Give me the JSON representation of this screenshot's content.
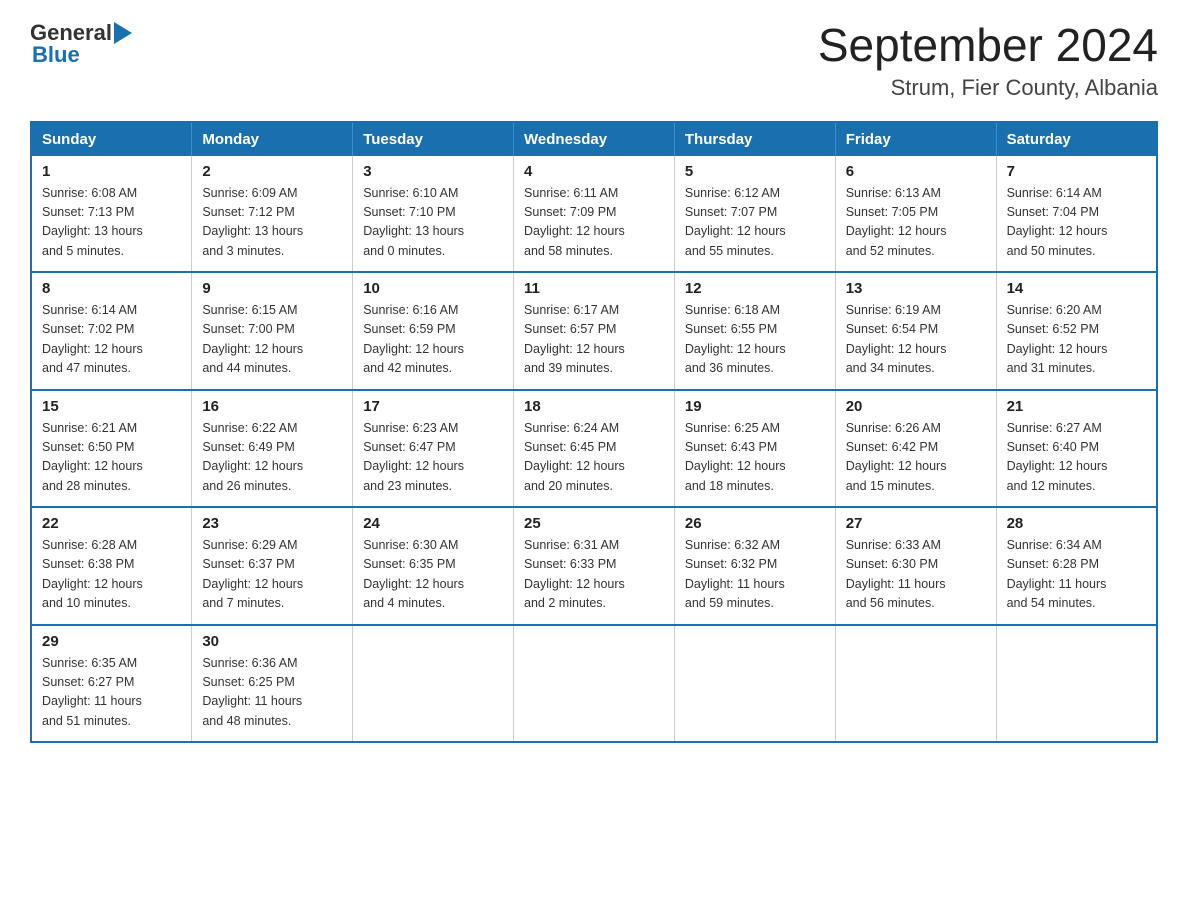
{
  "header": {
    "logo_general": "General",
    "logo_blue": "Blue",
    "month_year": "September 2024",
    "location": "Strum, Fier County, Albania"
  },
  "days_of_week": [
    "Sunday",
    "Monday",
    "Tuesday",
    "Wednesday",
    "Thursday",
    "Friday",
    "Saturday"
  ],
  "weeks": [
    [
      {
        "day": "1",
        "sunrise": "6:08 AM",
        "sunset": "7:13 PM",
        "daylight": "13 hours and 5 minutes."
      },
      {
        "day": "2",
        "sunrise": "6:09 AM",
        "sunset": "7:12 PM",
        "daylight": "13 hours and 3 minutes."
      },
      {
        "day": "3",
        "sunrise": "6:10 AM",
        "sunset": "7:10 PM",
        "daylight": "13 hours and 0 minutes."
      },
      {
        "day": "4",
        "sunrise": "6:11 AM",
        "sunset": "7:09 PM",
        "daylight": "12 hours and 58 minutes."
      },
      {
        "day": "5",
        "sunrise": "6:12 AM",
        "sunset": "7:07 PM",
        "daylight": "12 hours and 55 minutes."
      },
      {
        "day": "6",
        "sunrise": "6:13 AM",
        "sunset": "7:05 PM",
        "daylight": "12 hours and 52 minutes."
      },
      {
        "day": "7",
        "sunrise": "6:14 AM",
        "sunset": "7:04 PM",
        "daylight": "12 hours and 50 minutes."
      }
    ],
    [
      {
        "day": "8",
        "sunrise": "6:14 AM",
        "sunset": "7:02 PM",
        "daylight": "12 hours and 47 minutes."
      },
      {
        "day": "9",
        "sunrise": "6:15 AM",
        "sunset": "7:00 PM",
        "daylight": "12 hours and 44 minutes."
      },
      {
        "day": "10",
        "sunrise": "6:16 AM",
        "sunset": "6:59 PM",
        "daylight": "12 hours and 42 minutes."
      },
      {
        "day": "11",
        "sunrise": "6:17 AM",
        "sunset": "6:57 PM",
        "daylight": "12 hours and 39 minutes."
      },
      {
        "day": "12",
        "sunrise": "6:18 AM",
        "sunset": "6:55 PM",
        "daylight": "12 hours and 36 minutes."
      },
      {
        "day": "13",
        "sunrise": "6:19 AM",
        "sunset": "6:54 PM",
        "daylight": "12 hours and 34 minutes."
      },
      {
        "day": "14",
        "sunrise": "6:20 AM",
        "sunset": "6:52 PM",
        "daylight": "12 hours and 31 minutes."
      }
    ],
    [
      {
        "day": "15",
        "sunrise": "6:21 AM",
        "sunset": "6:50 PM",
        "daylight": "12 hours and 28 minutes."
      },
      {
        "day": "16",
        "sunrise": "6:22 AM",
        "sunset": "6:49 PM",
        "daylight": "12 hours and 26 minutes."
      },
      {
        "day": "17",
        "sunrise": "6:23 AM",
        "sunset": "6:47 PM",
        "daylight": "12 hours and 23 minutes."
      },
      {
        "day": "18",
        "sunrise": "6:24 AM",
        "sunset": "6:45 PM",
        "daylight": "12 hours and 20 minutes."
      },
      {
        "day": "19",
        "sunrise": "6:25 AM",
        "sunset": "6:43 PM",
        "daylight": "12 hours and 18 minutes."
      },
      {
        "day": "20",
        "sunrise": "6:26 AM",
        "sunset": "6:42 PM",
        "daylight": "12 hours and 15 minutes."
      },
      {
        "day": "21",
        "sunrise": "6:27 AM",
        "sunset": "6:40 PM",
        "daylight": "12 hours and 12 minutes."
      }
    ],
    [
      {
        "day": "22",
        "sunrise": "6:28 AM",
        "sunset": "6:38 PM",
        "daylight": "12 hours and 10 minutes."
      },
      {
        "day": "23",
        "sunrise": "6:29 AM",
        "sunset": "6:37 PM",
        "daylight": "12 hours and 7 minutes."
      },
      {
        "day": "24",
        "sunrise": "6:30 AM",
        "sunset": "6:35 PM",
        "daylight": "12 hours and 4 minutes."
      },
      {
        "day": "25",
        "sunrise": "6:31 AM",
        "sunset": "6:33 PM",
        "daylight": "12 hours and 2 minutes."
      },
      {
        "day": "26",
        "sunrise": "6:32 AM",
        "sunset": "6:32 PM",
        "daylight": "11 hours and 59 minutes."
      },
      {
        "day": "27",
        "sunrise": "6:33 AM",
        "sunset": "6:30 PM",
        "daylight": "11 hours and 56 minutes."
      },
      {
        "day": "28",
        "sunrise": "6:34 AM",
        "sunset": "6:28 PM",
        "daylight": "11 hours and 54 minutes."
      }
    ],
    [
      {
        "day": "29",
        "sunrise": "6:35 AM",
        "sunset": "6:27 PM",
        "daylight": "11 hours and 51 minutes."
      },
      {
        "day": "30",
        "sunrise": "6:36 AM",
        "sunset": "6:25 PM",
        "daylight": "11 hours and 48 minutes."
      },
      null,
      null,
      null,
      null,
      null
    ]
  ],
  "labels": {
    "sunrise": "Sunrise:",
    "sunset": "Sunset:",
    "daylight": "Daylight:"
  }
}
